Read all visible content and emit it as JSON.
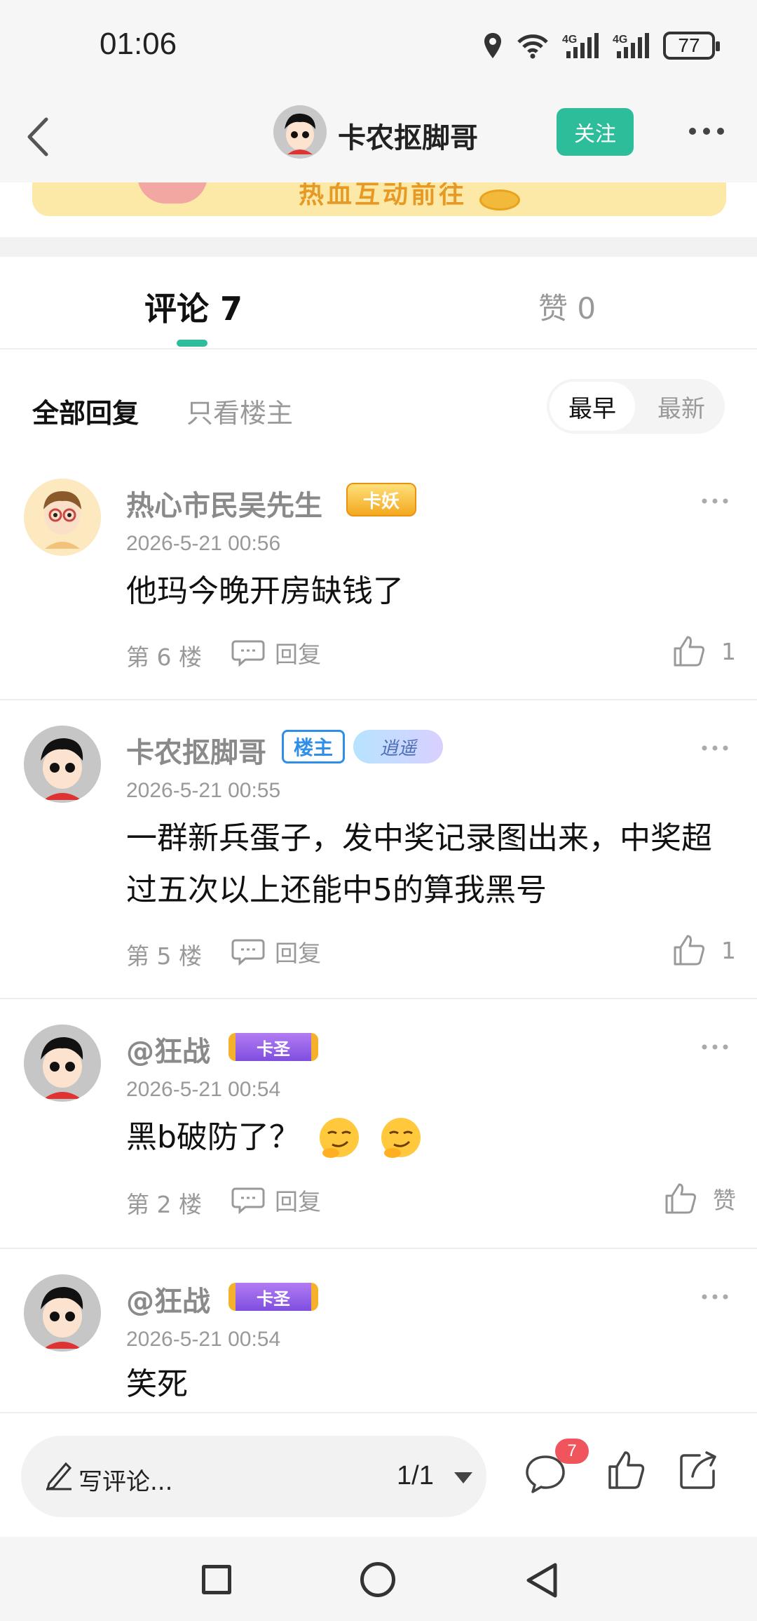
{
  "status_bar": {
    "time": "01:06",
    "battery": "77"
  },
  "header": {
    "username": "卡农抠脚哥",
    "follow_label": "关注"
  },
  "banner": {
    "text": "热血互动前往"
  },
  "tabs": {
    "comments_label": "评论 7",
    "likes_label": "赞 0"
  },
  "filters": {
    "all_label": "全部回复",
    "owner_only_label": "只看楼主",
    "sort_early": "最早",
    "sort_new": "最新"
  },
  "comments": [
    {
      "name": "热心市民吴先生",
      "badges": [
        "卡妖"
      ],
      "time": "2026-5-21 00:56",
      "text": "他玛今晚开房缺钱了",
      "floor": "第 6 楼",
      "reply_label": "回复",
      "likes": "1"
    },
    {
      "name": "卡农抠脚哥",
      "badges": [
        "楼主",
        "逍遥"
      ],
      "time": "2026-5-21 00:55",
      "text": "一群新兵蛋子，发中奖记录图出来，中奖超过五次以上还能中5的算我黑号",
      "floor": "第 5 楼",
      "reply_label": "回复",
      "likes": "1"
    },
    {
      "name": "@狂战",
      "badges": [
        "卡圣"
      ],
      "time": "2026-5-21 00:54",
      "text": "黑b破防了？",
      "floor": "第 2 楼",
      "reply_label": "回复",
      "likes": "赞"
    },
    {
      "name": "@狂战",
      "badges": [
        "卡圣"
      ],
      "time": "2026-5-21 00:54",
      "text": "笑死"
    }
  ],
  "action_bar": {
    "placeholder": "写评论...",
    "page_indicator": "1/1",
    "comment_count": "7"
  },
  "colors": {
    "accent": "#2dbd9b",
    "owner_badge": "#2f8fe8",
    "count_badge": "#f0545c"
  }
}
